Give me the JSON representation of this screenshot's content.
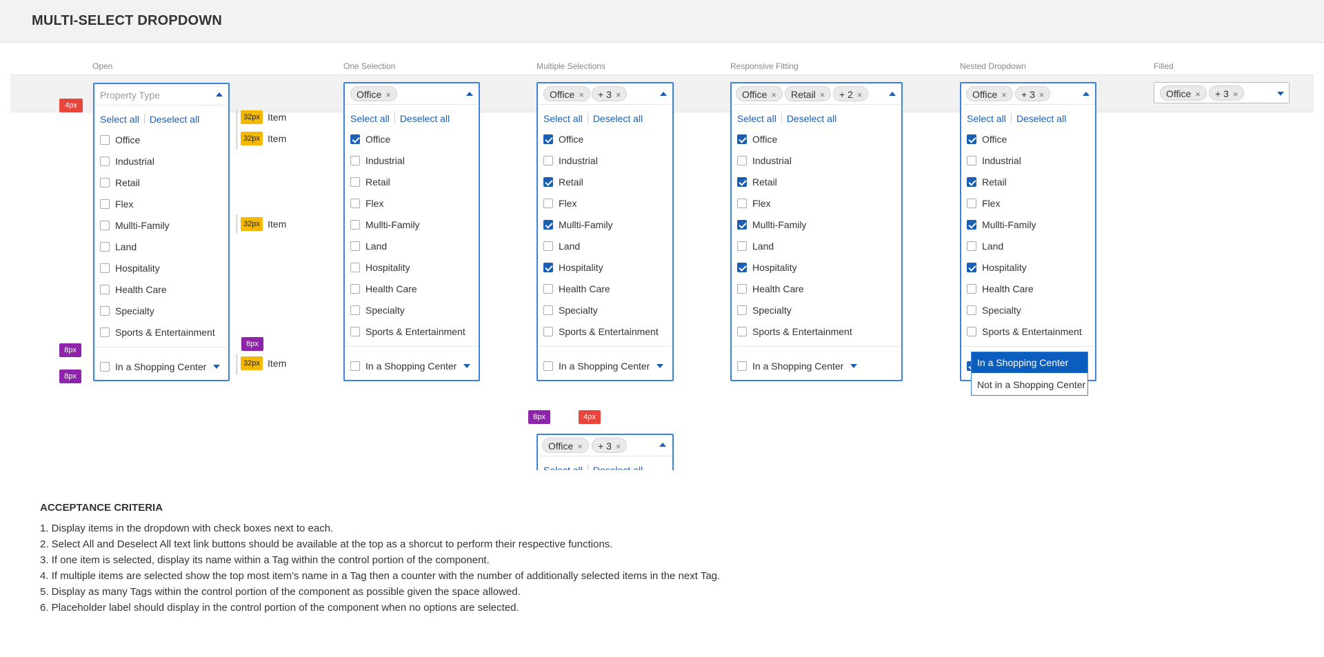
{
  "page_title": "MULTI-SELECT DROPDOWN",
  "columns": [
    {
      "title": "Open"
    },
    {
      "title": "One Selection"
    },
    {
      "title": "Multiple Selections"
    },
    {
      "title": "Responsive Fitting"
    },
    {
      "title": "Nested Dropdown"
    },
    {
      "title": "Filled"
    }
  ],
  "placeholder": "Property Type",
  "select_all": "Select all",
  "deselect_all": "Deselect all",
  "items": [
    "Office",
    "Industrial",
    "Retail",
    "Flex",
    "Mullti-Family",
    "Land",
    "Hospitality",
    "Health Care",
    "Specialty",
    "Sports & Entertainment"
  ],
  "nested_label": "In a Shopping Center",
  "tags": {
    "office": "Office",
    "retail": "Retail",
    "plus3": "+ 3",
    "plus2": "+ 2",
    "remove": "×"
  },
  "checked": {
    "open": [],
    "one": [
      0
    ],
    "multi": [
      0,
      2,
      4,
      6
    ],
    "responsive": [
      0,
      2,
      4,
      6
    ],
    "nested": [
      0,
      2,
      4,
      6
    ]
  },
  "nested_menu": {
    "selected": "In a Shopping Center",
    "other": "Not in a Shopping Center"
  },
  "annotations": {
    "px4": "4px",
    "px8": "8px",
    "px32": "32px",
    "item": "Item"
  },
  "criteria": {
    "heading": "ACCEPTANCE CRITERIA",
    "lines": [
      "1. Display items in the dropdown with check boxes next to each.",
      "2. Select All and Deselect All text link buttons should be available at the top as a shorcut to perform their respective functions.",
      "3. If one item is selected, display its name within a Tag within the control portion of the component.",
      "4. If multiple items are selected show the top most item's name in a Tag then a counter with the number of additionally selected items in the next Tag.",
      "5. Display as many Tags within the control portion of the component as possible given the space allowed.",
      "6. Placeholder label should display in the control portion of the component when no options are selected."
    ]
  }
}
